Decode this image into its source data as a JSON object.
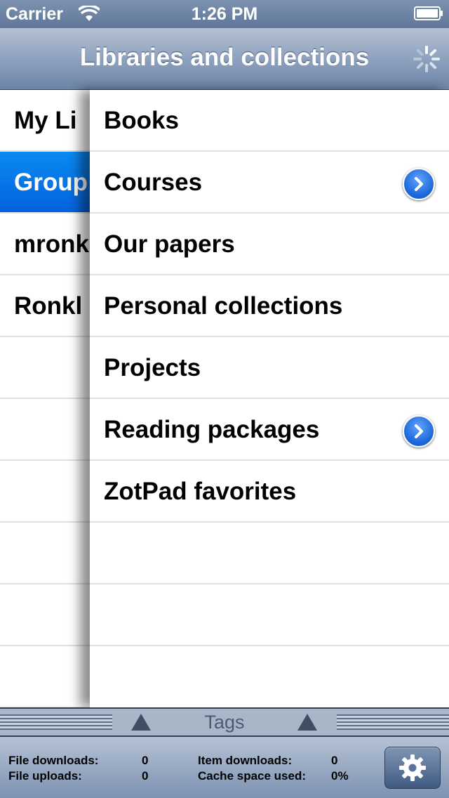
{
  "status_bar": {
    "carrier": "Carrier",
    "time": "1:26 PM"
  },
  "nav": {
    "title": "Libraries and collections",
    "activity_icon": "spinner-icon"
  },
  "libraries": [
    {
      "label": "My Li"
    },
    {
      "label": "Group"
    },
    {
      "label": "mronk"
    },
    {
      "label": "Ronkl"
    },
    {
      "label": ""
    },
    {
      "label": ""
    },
    {
      "label": ""
    },
    {
      "label": ""
    },
    {
      "label": ""
    },
    {
      "label": ""
    }
  ],
  "collections": [
    {
      "label": "Books",
      "has_children": false
    },
    {
      "label": "Courses",
      "has_children": true
    },
    {
      "label": "Our papers",
      "has_children": false
    },
    {
      "label": "Personal collections",
      "has_children": false
    },
    {
      "label": "Projects",
      "has_children": false
    },
    {
      "label": "Reading packages",
      "has_children": true
    },
    {
      "label": "ZotPad favorites",
      "has_children": false
    },
    {
      "label": "",
      "has_children": false
    },
    {
      "label": "",
      "has_children": false
    },
    {
      "label": "",
      "has_children": false
    }
  ],
  "tags_bar": {
    "label": "Tags"
  },
  "toolbar": {
    "file_downloads_label": "File downloads:",
    "file_downloads_value": "0",
    "file_uploads_label": "File uploads:",
    "file_uploads_value": "0",
    "item_downloads_label": "Item downloads:",
    "item_downloads_value": "0",
    "cache_space_label": "Cache space used:",
    "cache_space_value": "0%",
    "settings_icon": "gear-icon"
  },
  "colors": {
    "selection": "#0a7cf0",
    "bar": "#6d84a6"
  }
}
